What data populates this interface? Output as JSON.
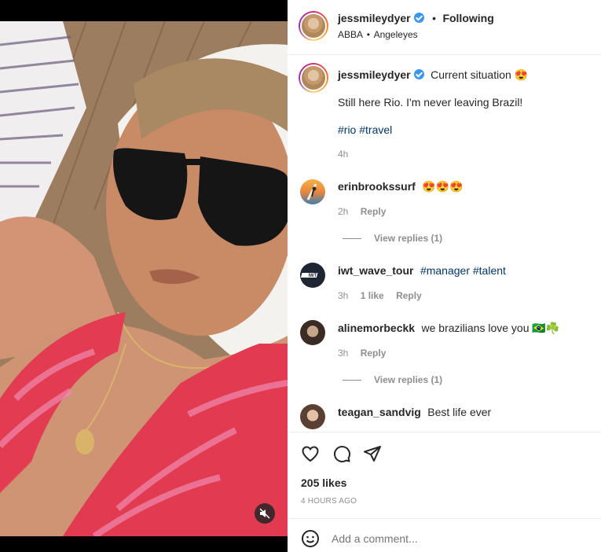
{
  "post": {
    "author": "jessmileydyer",
    "follow_separator": "•",
    "follow_label": "Following",
    "audio": "ABBA",
    "audio_separator": "•",
    "location": "Angeleyes"
  },
  "caption": {
    "author": "jessmileydyer",
    "text": "Current situation 😍",
    "body": "Still here Rio. I'm never leaving Brazil!",
    "hashtags": "#rio #travel",
    "time": "4h"
  },
  "comments": [
    {
      "author": "erinbrookssurf",
      "text": "😍😍😍",
      "time": "2h",
      "likes": "",
      "reply_label": "Reply",
      "view_replies": "View replies (1)"
    },
    {
      "author": "iwt_wave_tour",
      "text": "#manager #talent",
      "time": "3h",
      "likes": "1 like",
      "reply_label": "Reply",
      "view_replies": ""
    },
    {
      "author": "alinemorbeckk",
      "text": "we brazilians love you 🇧🇷☘️",
      "time": "3h",
      "likes": "",
      "reply_label": "Reply",
      "view_replies": "View replies (1)"
    },
    {
      "author": "teagan_sandvig",
      "text": "Best life ever",
      "time": "",
      "likes": "",
      "reply_label": "",
      "view_replies": ""
    }
  ],
  "stats": {
    "likes": "205 likes",
    "timestamp": "4 HOURS AGO"
  },
  "comment_box": {
    "placeholder": "Add a comment..."
  },
  "icons": {
    "like": "heart-icon",
    "comment": "comment-bubble-icon",
    "share": "paper-plane-icon",
    "emoji": "smiley-face-icon",
    "mute": "speaker-muted-icon",
    "verified": "verified-badge-icon"
  },
  "colors": {
    "link": "#00376b",
    "verified": "#3897f0",
    "muted_text": "#8e8e8e"
  }
}
